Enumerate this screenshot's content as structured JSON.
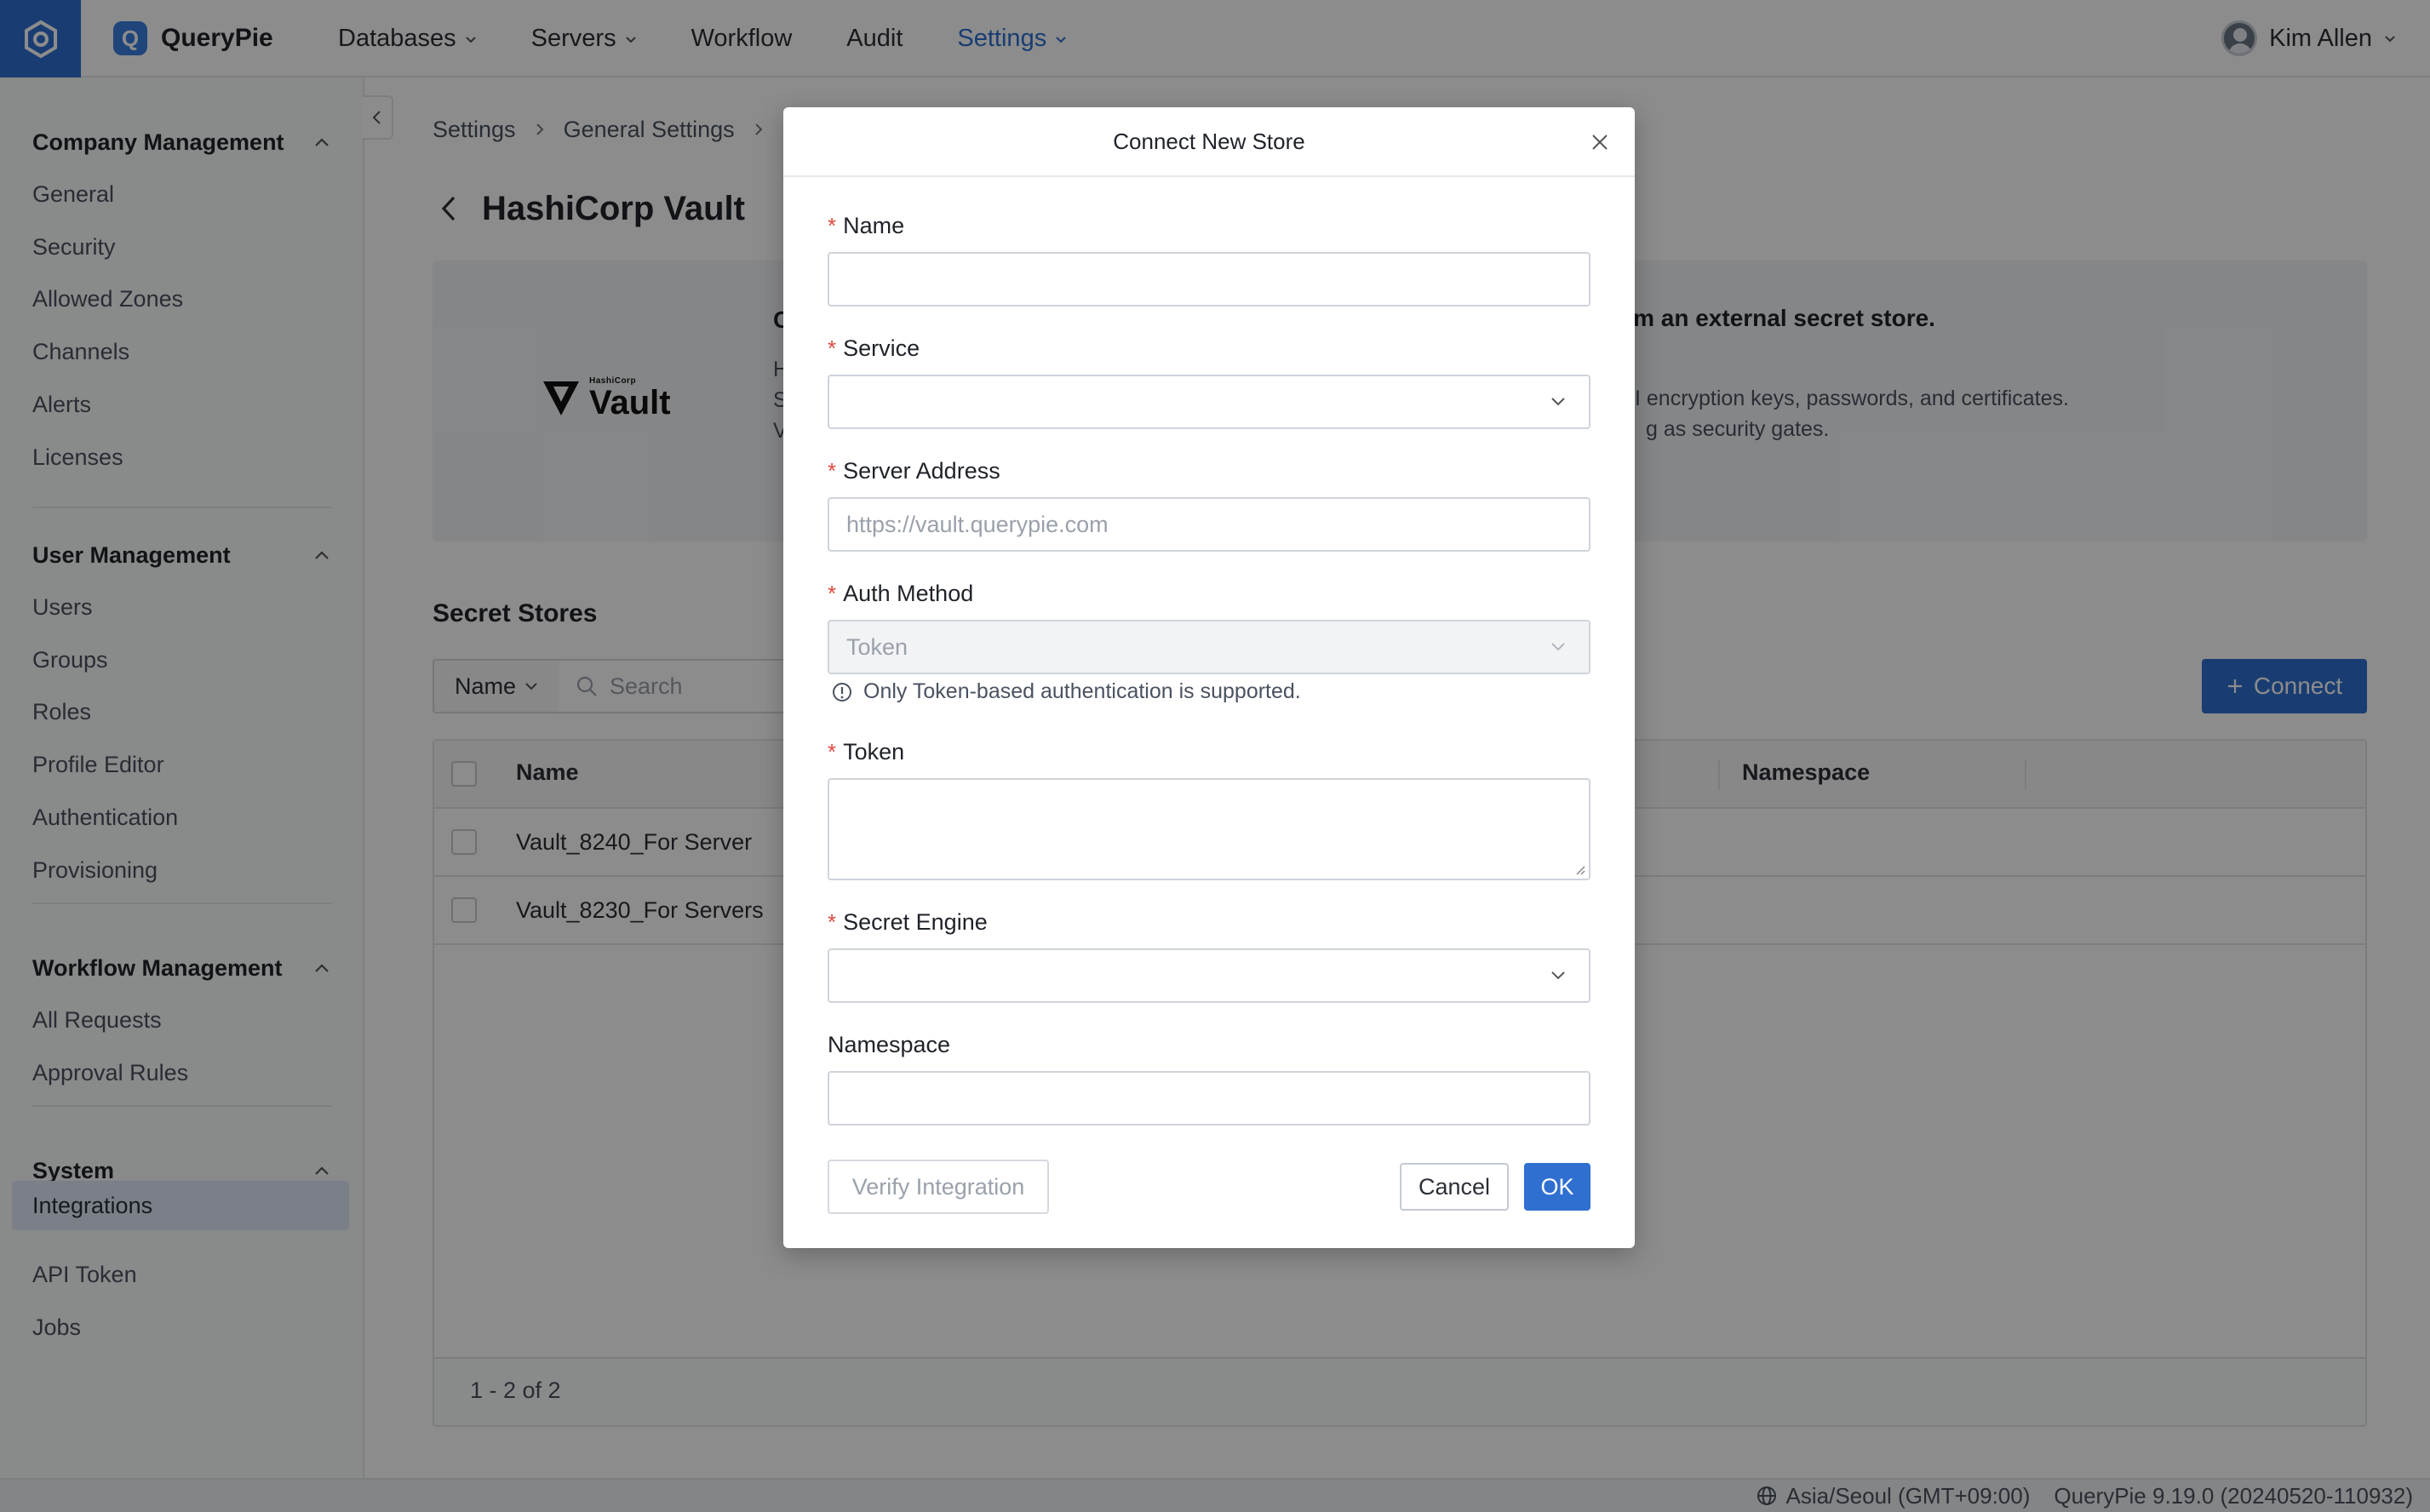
{
  "app": {
    "brand": "QueryPie",
    "brand_icon_letter": "Q",
    "accent_color": "#2f6fd0"
  },
  "nav": {
    "items": [
      {
        "label": "Databases",
        "dropdown": true
      },
      {
        "label": "Servers",
        "dropdown": true
      },
      {
        "label": "Workflow",
        "dropdown": false
      },
      {
        "label": "Audit",
        "dropdown": false
      },
      {
        "label": "Settings",
        "dropdown": true,
        "active": true
      }
    ],
    "user": "Kim Allen"
  },
  "sidebar": {
    "sections": [
      {
        "title": "Company Management",
        "items": [
          "General",
          "Security",
          "Allowed Zones",
          "Channels",
          "Alerts",
          "Licenses"
        ]
      },
      {
        "title": "User Management",
        "items": [
          "Users",
          "Groups",
          "Roles",
          "Profile Editor",
          "Authentication",
          "Provisioning"
        ]
      },
      {
        "title": "Workflow Management",
        "items": [
          "All Requests",
          "Approval Rules"
        ]
      },
      {
        "title": "System",
        "items": [
          "Integrations",
          "API Token",
          "Jobs"
        ],
        "active": "Integrations"
      }
    ]
  },
  "breadcrumb": [
    "Settings",
    "General Settings"
  ],
  "page": {
    "title": "HashiCorp Vault",
    "card": {
      "logo_small": "HashiCorp",
      "logo_text": "Vault",
      "heading_fragment": "om an external secret store.",
      "line1_fragment": "I encryption keys, passwords, and certificates.",
      "line2_fragment": "g as security gates.",
      "left_fragments": [
        "C",
        "H",
        "S",
        "V"
      ]
    },
    "stores_title": "Secret Stores",
    "filter_label": "Name",
    "search_placeholder": "Search",
    "connect_label": "Connect",
    "table": {
      "columns": [
        "Name",
        "Namespace"
      ],
      "rows": [
        {
          "name": "Vault_8240_For Server"
        },
        {
          "name": "Vault_8230_For Servers"
        }
      ],
      "pagination": "1 - 2 of 2"
    }
  },
  "status": {
    "timezone": "Asia/Seoul (GMT+09:00)",
    "version": "QueryPie 9.19.0 (20240520-110932)"
  },
  "modal": {
    "title": "Connect New Store",
    "fields": {
      "name": {
        "label": "Name",
        "value": ""
      },
      "service": {
        "label": "Service",
        "value": ""
      },
      "server_address": {
        "label": "Server Address",
        "placeholder": "https://vault.querypie.com"
      },
      "auth_method": {
        "label": "Auth Method",
        "value": "Token",
        "hint": "Only Token-based authentication is supported."
      },
      "token": {
        "label": "Token",
        "value": ""
      },
      "secret_engine": {
        "label": "Secret Engine",
        "value": ""
      },
      "namespace": {
        "label": "Namespace",
        "value": ""
      }
    },
    "verify_label": "Verify Integration",
    "cancel_label": "Cancel",
    "ok_label": "OK"
  }
}
